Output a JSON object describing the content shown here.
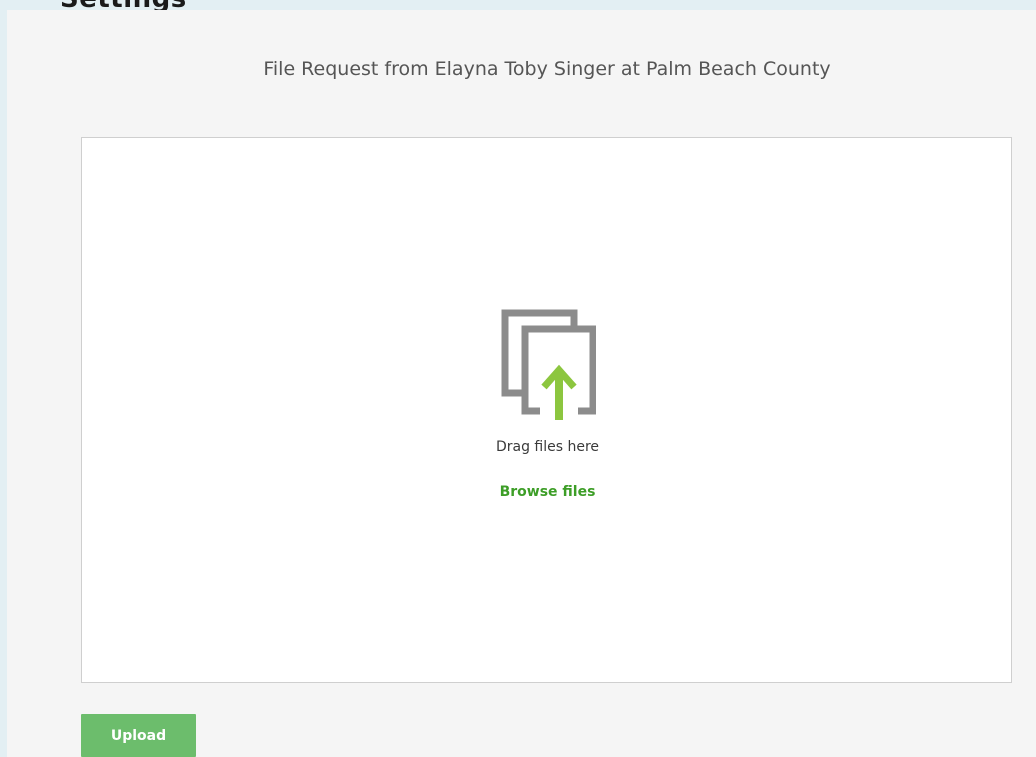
{
  "header": {
    "clipped_heading": "Settings"
  },
  "request": {
    "title": "File Request from Elayna Toby Singer at Palm Beach County"
  },
  "dropzone": {
    "drag_text": "Drag files here",
    "browse_label": "Browse files",
    "icon": "upload-files-icon"
  },
  "actions": {
    "upload_label": "Upload"
  },
  "colors": {
    "accent_green": "#3d9e27",
    "arrow_green": "#8cc63f",
    "button_green": "#6cbd6c",
    "icon_gray": "#8c8c8c",
    "background": "#e3eff3",
    "panel": "#f5f5f5"
  }
}
